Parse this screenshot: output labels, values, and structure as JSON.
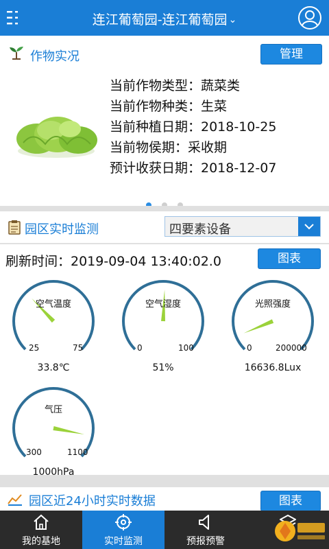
{
  "header": {
    "title": "连江葡萄园-连江葡萄园",
    "chevron": "⌄"
  },
  "crop": {
    "title": "作物实况",
    "manage_label": "管理",
    "lines": [
      "当前作物类型：蔬菜类",
      "当前作物种类：生菜",
      "当前种植日期：2018-10-25",
      "当前物侯期：采收期",
      "预计收获日期：2018-12-07"
    ],
    "carousel": {
      "pages": 3,
      "active": 0
    }
  },
  "monitor": {
    "title": "园区实时监测",
    "device_select": "四要素设备",
    "refresh": "刷新时间：2019-09-04 13:40:02.0",
    "chart_label": "图表",
    "gauges": [
      {
        "label": "空气温度",
        "min": "25",
        "max": "75",
        "value": 33.8,
        "display": "33.8℃",
        "range": [
          0,
          100
        ]
      },
      {
        "label": "空气湿度",
        "min": "0",
        "max": "100",
        "value": 51,
        "display": "51%",
        "range": [
          0,
          100
        ]
      },
      {
        "label": "光照强度",
        "min": "0",
        "max": "200000",
        "value": 16636.8,
        "display": "16636.8Lux",
        "range": [
          0,
          200000
        ]
      },
      {
        "label": "气压",
        "min": "300",
        "max": "1100",
        "value": 1000,
        "display": "1000hPa",
        "range": [
          300,
          1100
        ]
      }
    ]
  },
  "h24": {
    "title": "园区近24小时实时数据",
    "chart_label": "图表"
  },
  "nav": {
    "items": [
      {
        "label": "我的基地",
        "icon": "home-icon",
        "active": false
      },
      {
        "label": "实时监测",
        "icon": "target-icon",
        "active": true
      },
      {
        "label": "预报预警",
        "icon": "speaker-icon",
        "active": false
      },
      {
        "label": "",
        "icon": "layers-icon",
        "active": false
      }
    ]
  },
  "colors": {
    "accent": "#1a7ed6",
    "gauge_arc": "#2f6f97",
    "needle": "#9bd23a"
  }
}
